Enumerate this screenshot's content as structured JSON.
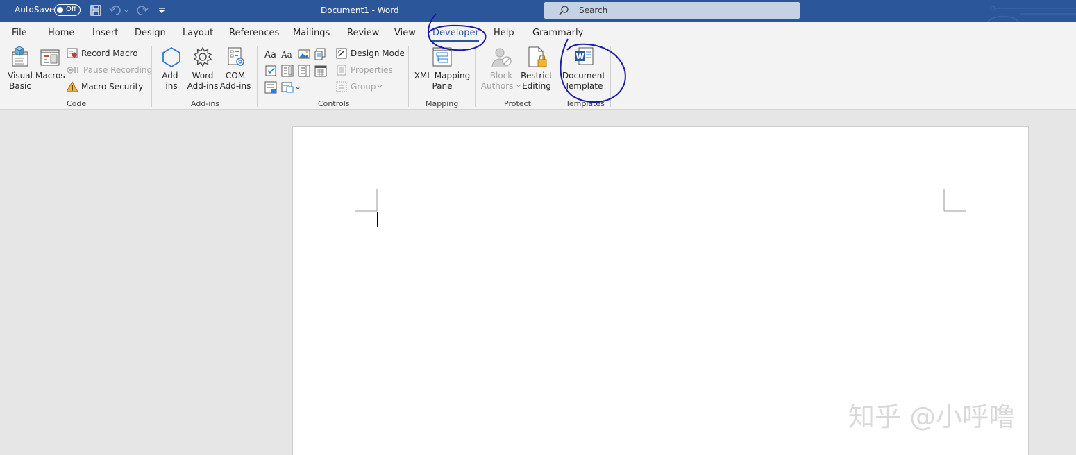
{
  "titlebar": {
    "autosave_label": "AutoSave",
    "autosave_state": "Off",
    "document_title": "Document1  -  Word",
    "search_placeholder": "Search"
  },
  "tabs": [
    "File",
    "Home",
    "Insert",
    "Design",
    "Layout",
    "References",
    "Mailings",
    "Review",
    "View",
    "Developer",
    "Help",
    "Grammarly"
  ],
  "active_tab": "Developer",
  "ribbon": {
    "code": {
      "label": "Code",
      "visual_basic": [
        "Visual",
        "Basic"
      ],
      "macros": "Macros",
      "record_macro": "Record Macro",
      "pause_recording": "Pause Recording",
      "macro_security": "Macro Security"
    },
    "addins": {
      "label": "Add-ins",
      "addins_btn": [
        "Add-",
        "ins"
      ],
      "word_addins": [
        "Word",
        "Add-ins"
      ],
      "com_addins": [
        "COM",
        "Add-ins"
      ]
    },
    "controls": {
      "label": "Controls",
      "design_mode": "Design Mode",
      "properties": "Properties",
      "group": "Group"
    },
    "mapping": {
      "label": "Mapping",
      "xml_mapping_pane": [
        "XML Mapping",
        "Pane"
      ]
    },
    "protect": {
      "label": "Protect",
      "block_authors": [
        "Block",
        "Authors"
      ],
      "restrict_editing": [
        "Restrict",
        "Editing"
      ]
    },
    "templates": {
      "label": "Templates",
      "document_template": [
        "Document",
        "Template"
      ]
    }
  },
  "watermark": "知乎 @小呼噜",
  "colors": {
    "title_bar": "#2b579a",
    "annotation_ink": "#1a1aa6",
    "ribbon_bg": "#f3f3f3",
    "canvas_bg": "#e6e6e6"
  }
}
